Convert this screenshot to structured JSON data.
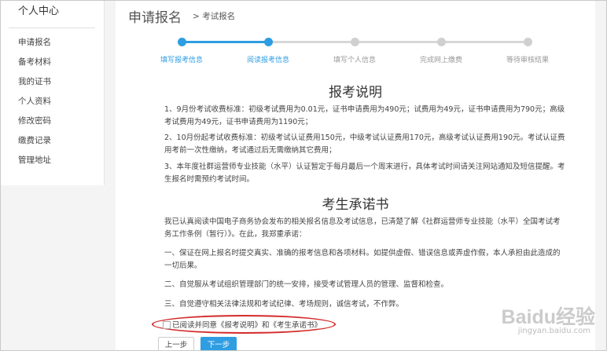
{
  "sidebar": {
    "title": "个人中心",
    "items": [
      {
        "label": "申请报名"
      },
      {
        "label": "备考材料"
      },
      {
        "label": "我的证书"
      },
      {
        "label": "个人资料"
      },
      {
        "label": "修改密码"
      },
      {
        "label": "缴费记录"
      },
      {
        "label": "管理地址"
      }
    ]
  },
  "header": {
    "title": "申请报名",
    "breadcrumb": "> 考试报名"
  },
  "steps": [
    {
      "label": "填写报考信息",
      "status": "done"
    },
    {
      "label": "阅读报考信息",
      "status": "current"
    },
    {
      "label": "填写个人信息",
      "status": "todo"
    },
    {
      "label": "完成网上缴费",
      "status": "todo"
    },
    {
      "label": "等待审核结果",
      "status": "todo"
    }
  ],
  "notice": {
    "title": "报考说明",
    "paragraphs": [
      "1、9月份考试收费标准：初级考试费用为0.01元，证书申请费用为490元；试费用为49元，证书申请费用为790元；高级考试费用为49元，证书申请费用为1190元；",
      "2、10月份起考试收费标准：初级考试认证费用150元，中级考试认证费用170元，高级考试认证费用190元。考试认证费用考前一次性缴纳，考试通过后无需缴纳其它费用；",
      "3、本年度社群运营师专业技能（水平）认证暂定于每月最后一个周末进行，具体考试时间请关注网站通知及短信提醒。考生报名时需预约考试时间。"
    ]
  },
  "pledge": {
    "title": "考生承诺书",
    "paragraphs": [
      "我已认真阅读中国电子商务协会发布的相关报名信息及考试信息，已清楚了解《社群运营师专业技能（水平）全国考试考务工作条例（暂行）》。在此，我郑重承诺：",
      "一、保证在网上报名时提交真实、准确的报考信息和各项材料。如提供虚假、错误信息或弄虚作假，本人承担由此造成的一切后果。",
      "二、自觉服从考试组织管理部门的统一安排，接受考试管理人员的管理、监督和检查。",
      "三、自觉遵守相关法律法规和考试纪律、考场规则，诚信考试，不作弊。"
    ]
  },
  "agree": {
    "label": "已阅读并同意《报考说明》和《考生承诺书》",
    "checked": false
  },
  "buttons": {
    "prev": "上一步",
    "next": "下一步"
  },
  "watermark": {
    "logo": "Baidu经验",
    "url": "jingyan.baidu.com"
  },
  "colors": {
    "accent": "#2f9de2",
    "highlight_circle": "#d42a2a"
  }
}
